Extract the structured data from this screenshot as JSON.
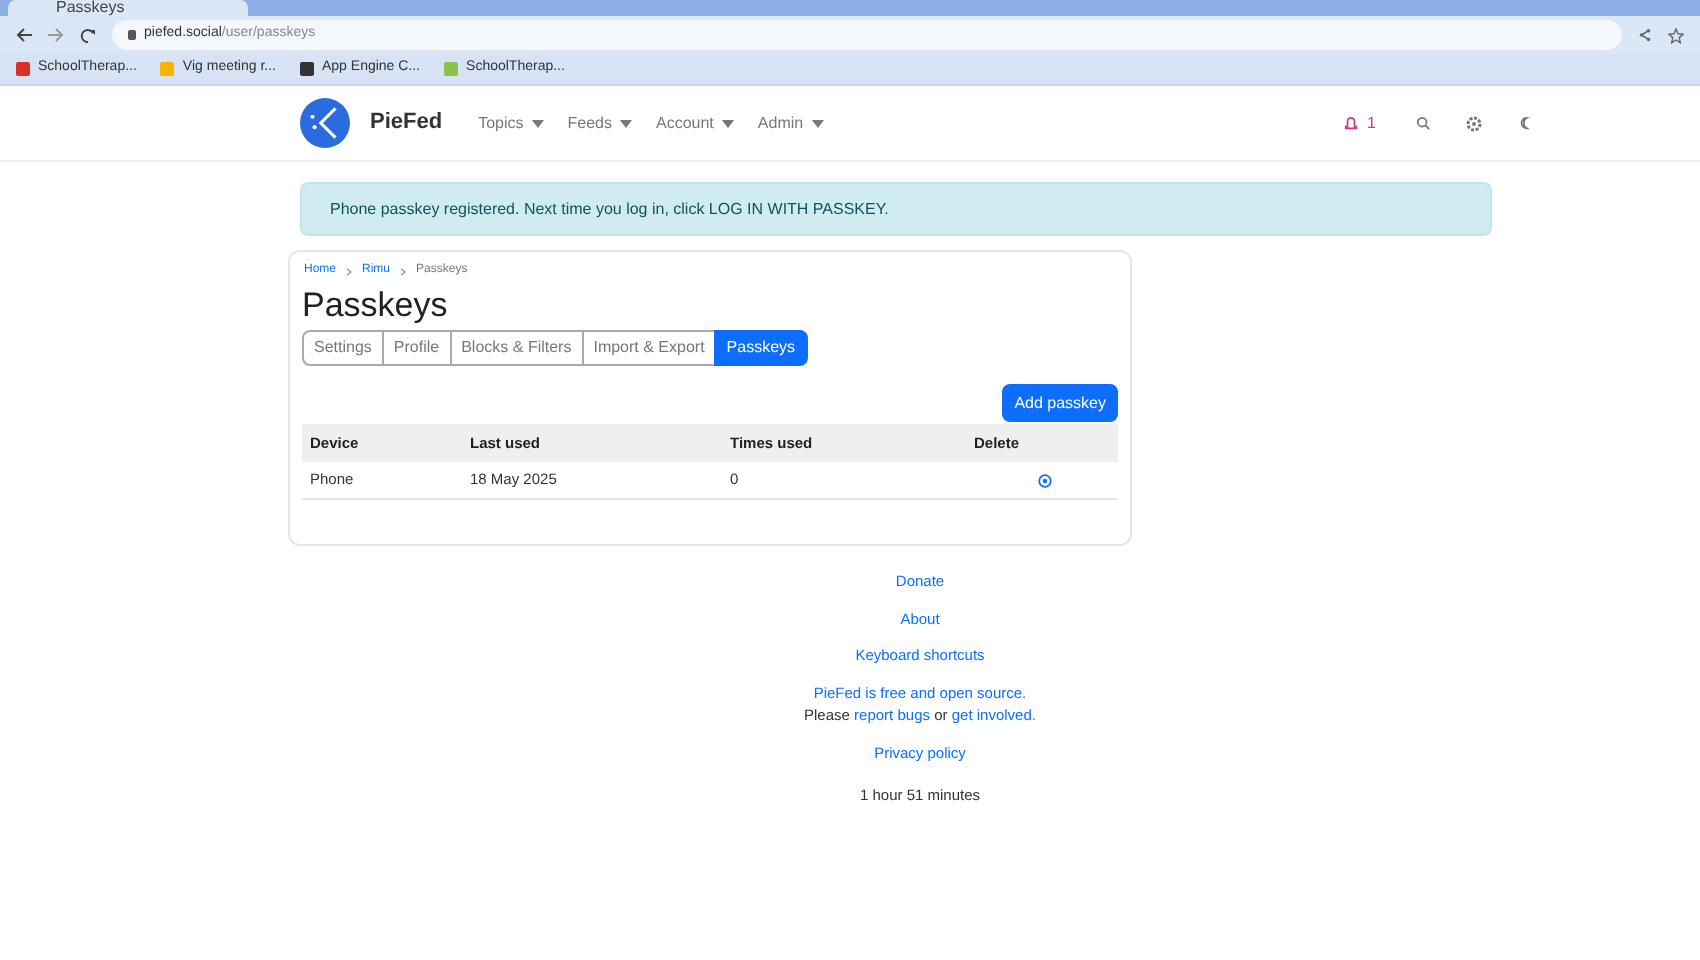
{
  "browser": {
    "tab_title": "Passkeys",
    "url_host": "piefed.social",
    "url_path": "/user/passkeys",
    "bookmarks": [
      {
        "label": "SchoolTherap...",
        "color": "#d93025"
      },
      {
        "label": "Vig meeting r...",
        "color": "#f4b400"
      },
      {
        "label": "App Engine C...",
        "color": "#333333"
      },
      {
        "label": "SchoolTherap...",
        "color": "#8bc34a"
      }
    ]
  },
  "nav": {
    "brand": "PieFed",
    "menus": [
      {
        "label": "Topics"
      },
      {
        "label": "Feeds"
      },
      {
        "label": "Account"
      },
      {
        "label": "Admin"
      }
    ],
    "notification_count": "1"
  },
  "alert": "Phone passkey registered. Next time you log in, click LOG IN WITH PASSKEY.",
  "breadcrumb": [
    "Home",
    "Rimu",
    "Passkeys"
  ],
  "title": "Passkeys",
  "tabs": [
    {
      "label": "Settings",
      "selected": false
    },
    {
      "label": "Profile",
      "selected": false
    },
    {
      "label": "Blocks & Filters",
      "selected": false
    },
    {
      "label": "Import & Export",
      "selected": false
    },
    {
      "label": "Passkeys",
      "selected": true
    }
  ],
  "add_button": "Add passkey",
  "table": {
    "columns": [
      "Device",
      "Last used",
      "Times used",
      "Delete"
    ],
    "rows": [
      {
        "device": "Phone",
        "last_used": "18 May 2025",
        "times_used": "0"
      }
    ]
  },
  "footer": {
    "links": [
      "Donate",
      "About",
      "Keyboard shortcuts"
    ],
    "open_source": "PieFed is free and open source.",
    "please": {
      "before": "Please",
      "link1": "report bugs",
      "middle": "or",
      "link2": "get involved."
    },
    "privacy": "Privacy policy",
    "elapsed": "1 hour 51 minutes"
  }
}
